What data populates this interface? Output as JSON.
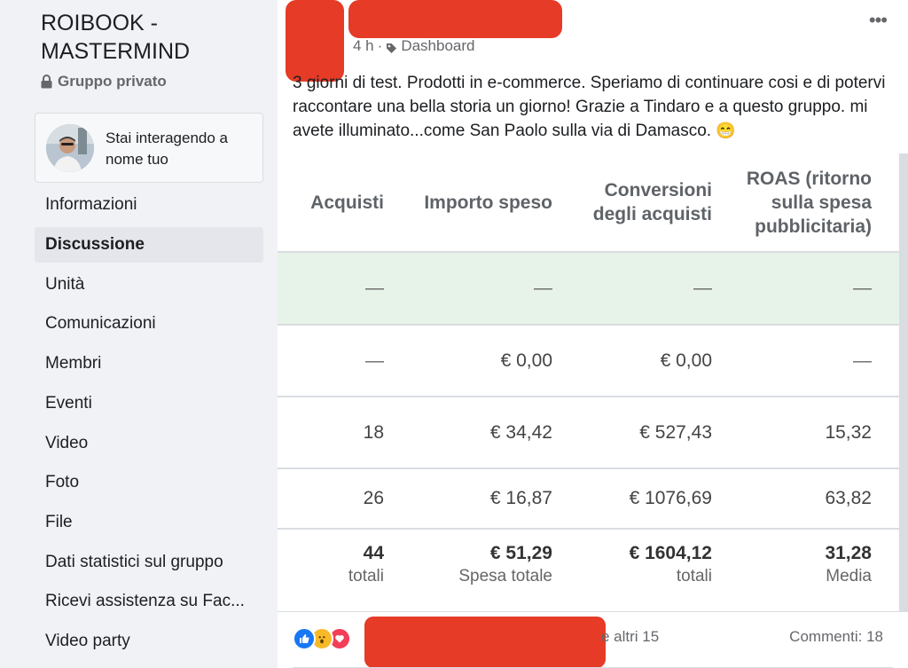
{
  "sidebar": {
    "group_name": "ROIBOOK - MASTERMIND",
    "privacy": "Gruppo privato",
    "identity_text": "Stai interagendo a nome tuo",
    "items": [
      {
        "label": "Informazioni",
        "active": false
      },
      {
        "label": "Discussione",
        "active": true
      },
      {
        "label": "Unità",
        "active": false
      },
      {
        "label": "Comunicazioni",
        "active": false
      },
      {
        "label": "Membri",
        "active": false
      },
      {
        "label": "Eventi",
        "active": false
      },
      {
        "label": "Video",
        "active": false
      },
      {
        "label": "Foto",
        "active": false
      },
      {
        "label": "File",
        "active": false
      },
      {
        "label": "Dati statistici sul gruppo",
        "active": false
      },
      {
        "label": "Ricevi assistenza su Fac...",
        "active": false
      },
      {
        "label": "Video party",
        "active": false
      }
    ]
  },
  "post": {
    "time": "4 h",
    "separator": "·",
    "topic": "Dashboard",
    "more": "•••",
    "text": "3 giorni di test. Prodotti in e-commerce. Speriamo di continuare cosi e di potervi raccontare una bella storia un giorno! Grazie a Tindaro e a questo gruppo. mi avete illuminato...come San Paolo sulla via di Damasco.",
    "emoji": "😁"
  },
  "table": {
    "headers": [
      "Acquisti",
      "Importo speso",
      "Conversioni degli acquisti",
      "ROAS (ritorno sulla spesa pubblicitaria)"
    ],
    "rows": [
      [
        "—",
        "—",
        "—",
        "—"
      ],
      [
        "—",
        "€ 0,00",
        "€ 0,00",
        "—"
      ],
      [
        "18",
        "€ 34,42",
        "€ 527,43",
        "15,32"
      ],
      [
        "26",
        "€ 16,87",
        "€ 1076,69",
        "63,82"
      ]
    ],
    "totals": [
      {
        "value": "44",
        "label": "totali"
      },
      {
        "value": "€ 51,29",
        "label": "Spesa totale"
      },
      {
        "value": "€ 1604,12",
        "label": "totali"
      },
      {
        "value": "31,28",
        "label": "Media"
      }
    ]
  },
  "footer": {
    "others_text": "e altri 15",
    "comments_text": "Commenti: 18",
    "reactions": [
      "like-icon",
      "wow-icon",
      "love-icon"
    ]
  },
  "colors": {
    "redaction": "#e53b27",
    "highlight_row": "#e7f3e8",
    "like": "#1877f2",
    "love": "#f33e58",
    "wow": "#f7b928"
  }
}
